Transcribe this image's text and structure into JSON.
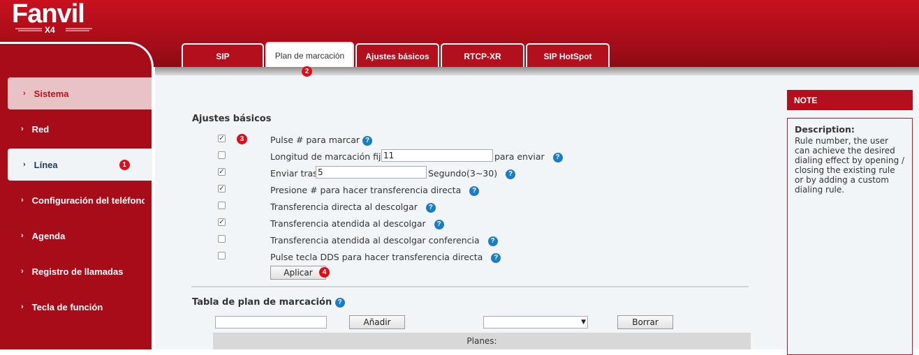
{
  "brand": {
    "logo": "Fanvil",
    "model": "X4"
  },
  "sidebar": {
    "items": [
      {
        "label": "Sistema"
      },
      {
        "label": "Red"
      },
      {
        "label": "Línea",
        "badge": "1"
      },
      {
        "label": "Configuración del teléfono"
      },
      {
        "label": "Agenda"
      },
      {
        "label": "Registro de llamadas"
      },
      {
        "label": "Tecla de función"
      }
    ]
  },
  "tabs": [
    {
      "label": "SIP"
    },
    {
      "label": "Plan de marcación",
      "badge": "2"
    },
    {
      "label": "Ajustes básicos"
    },
    {
      "label": "RTCP-XR"
    },
    {
      "label": "SIP HotSpot"
    }
  ],
  "basic": {
    "title": "Ajustes básicos",
    "badge": "3",
    "rows": [
      {
        "label": "Pulse # para marcar",
        "checked": true
      },
      {
        "label": "Longitud de marcación fija",
        "value": "11",
        "suffix": "para enviar",
        "checked": false
      },
      {
        "label": "Enviar tras",
        "value": "5",
        "suffix": "Segundo(3~30)",
        "checked": true
      },
      {
        "label": "Presione # para hacer transferencia directa",
        "checked": true
      },
      {
        "label": "Transferencia directa al descolgar",
        "checked": false
      },
      {
        "label": "Transferencia atendida al descolgar",
        "checked": true
      },
      {
        "label": "Transferencia atendida al descolgar conferencia",
        "checked": false
      },
      {
        "label": "Pulse tecla DDS para hacer transferencia directa",
        "checked": false
      }
    ],
    "apply_label": "Aplicar",
    "apply_badge": "4"
  },
  "dialplan": {
    "title": "Tabla de plan de marcación",
    "add_label": "Añadir",
    "delete_label": "Borrar",
    "select_value": "",
    "plans_header": "Planes:"
  },
  "note": {
    "title": "NOTE",
    "desc_title": "Description:",
    "desc_text": "Rule number, the user can achieve the desired dialing effect by opening / closing the existing rule or by adding a custom dialing rule."
  },
  "icons": {
    "help": "help-icon",
    "checkbox": "checkbox",
    "chevron": "chevron-right-icon"
  },
  "colors": {
    "brand_red": "#b30f1c",
    "badge_red": "#e00c17",
    "help_blue": "#1a7dc2"
  }
}
